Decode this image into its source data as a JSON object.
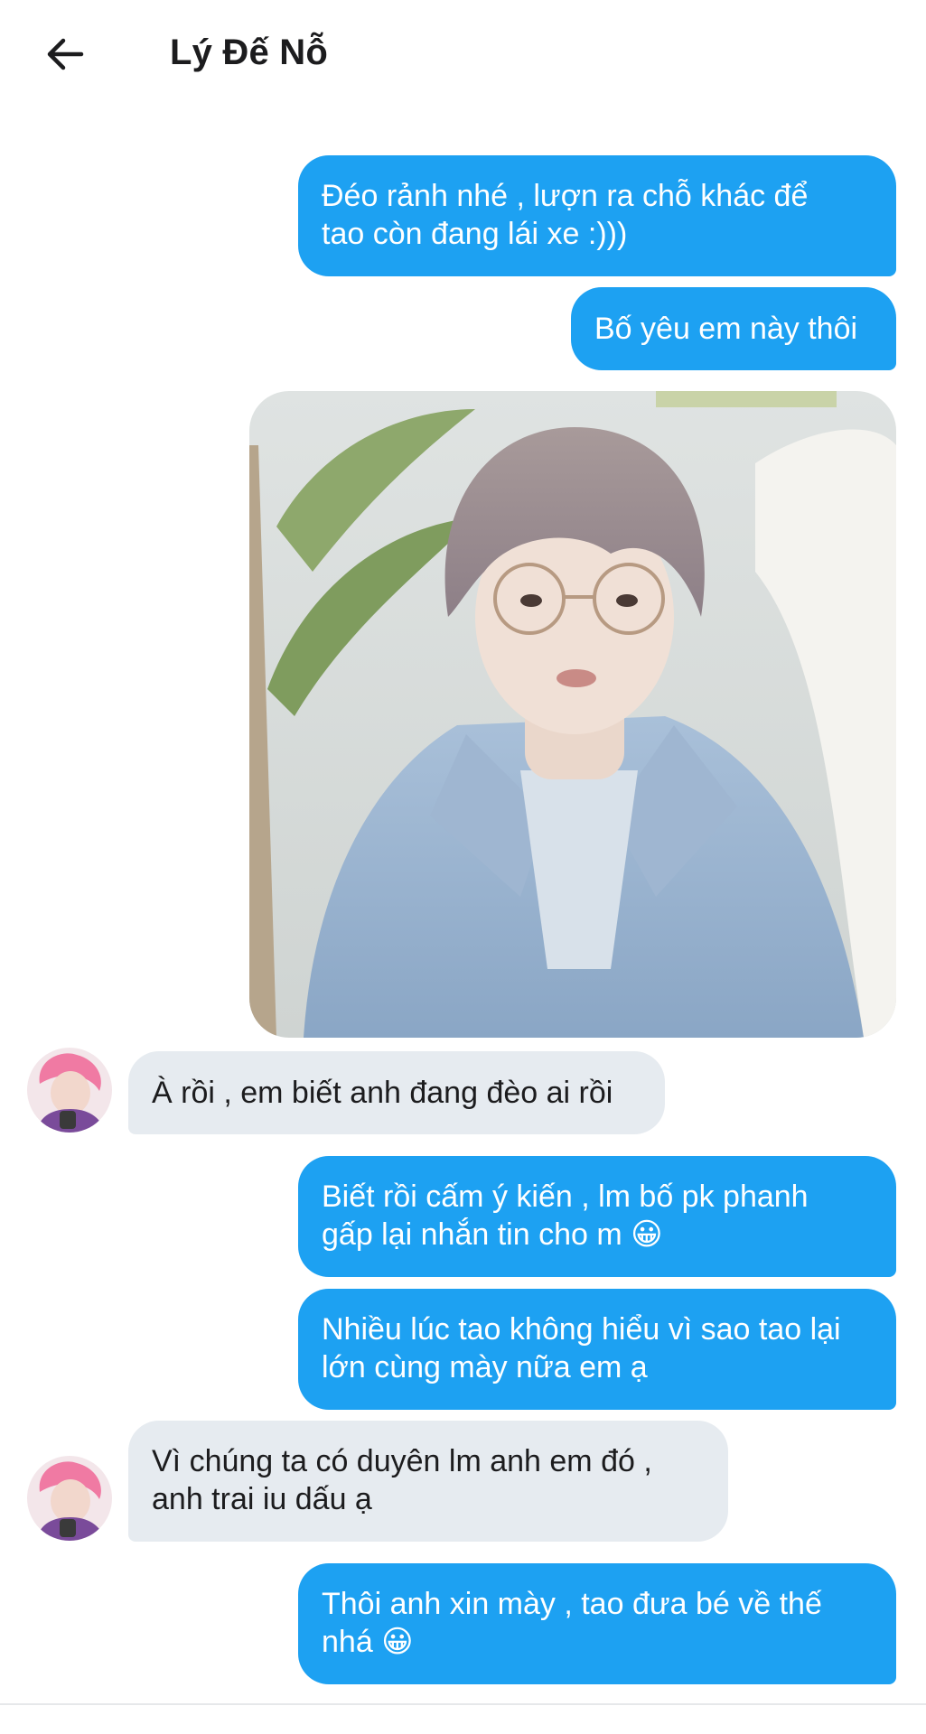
{
  "header": {
    "title": "Lý Đế Nỗ",
    "back_icon": "arrow-left-icon"
  },
  "colors": {
    "outgoing_bubble": "#1da1f2",
    "incoming_bubble": "#e6ebf0",
    "background": "#ffffff"
  },
  "messages": [
    {
      "sender": "me",
      "line1": "Đéo rảnh nhé , lượn ra chỗ khác để",
      "line2": "tao còn đang lái xe :)))"
    },
    {
      "sender": "me",
      "line1": "Bố yêu em này thôi"
    },
    {
      "sender": "me",
      "type": "photo"
    },
    {
      "sender": "them",
      "line1": "À rồi , em biết anh đang đèo ai rồi"
    },
    {
      "sender": "me",
      "line1": "Biết rồi cấm ý kiến , lm bố pk phanh",
      "line2": "gấp lại nhắn tin cho m 😀"
    },
    {
      "sender": "me",
      "line1": "Nhiều lúc tao không hiểu vì sao tao lại",
      "line2": "lớn cùng mày nữa em ạ"
    },
    {
      "sender": "them",
      "line1": "Vì chúng ta có duyên lm anh em đó ,",
      "line2": "anh trai iu dấu ạ"
    },
    {
      "sender": "me",
      "line1": "Thôi anh xin mày , tao đưa bé về thế",
      "line2": "nhá 😀"
    }
  ]
}
